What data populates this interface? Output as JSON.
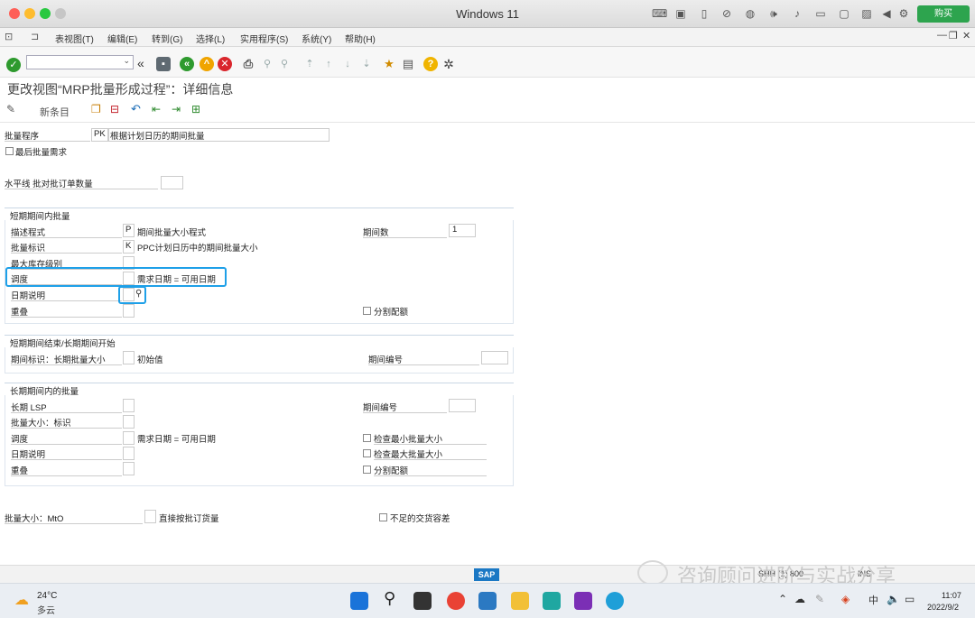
{
  "window": {
    "title": "Windows 11",
    "buy_label": "购买"
  },
  "menu": [
    "表视图(T)",
    "编辑(E)",
    "转到(G)",
    "选择(L)",
    "实用程序(S)",
    "系统(Y)",
    "帮助(H)"
  ],
  "page_title": "更改视图“MRP批量形成过程”：详细信息",
  "app_toolbar": {
    "new_entries": "新条目"
  },
  "form": {
    "lot_procedure": {
      "label": "批量程序",
      "code": "PK",
      "desc": "根据计划日历的期间批量"
    },
    "last_lot_exact": {
      "label": "最后批量需求"
    },
    "horizon": {
      "label": "水平线 批对批订单数量"
    },
    "short": {
      "title": "短期期间内批量",
      "desc_proc": {
        "label": "描述程式",
        "code": "P",
        "desc": "期间批量大小程式"
      },
      "periods": {
        "label": "期间数",
        "value": "1"
      },
      "lot_ind": {
        "label": "批量标识",
        "code": "K",
        "desc": "PPC计划日历中的期间批量大小"
      },
      "max_stock": {
        "label": "最大库存级别"
      },
      "scheduling": {
        "label": "调度",
        "desc": "需求日期 = 可用日期"
      },
      "date_spec": {
        "label": "日期说明"
      },
      "overlap": {
        "label": "重叠"
      },
      "split_quota": {
        "label": "分割配额"
      }
    },
    "transition": {
      "title": "短期期间结束/长期期间开始",
      "period_ind": {
        "label": "期间标识：长期批量大小",
        "desc": "初始值"
      },
      "period_no": {
        "label": "期间编号"
      }
    },
    "long": {
      "title": "长期期间内的批量",
      "lsp": {
        "label": "长期 LSP"
      },
      "period_no": {
        "label": "期间编号"
      },
      "lot_ind": {
        "label": "批量大小：标识"
      },
      "scheduling": {
        "label": "调度",
        "desc": "需求日期 = 可用日期"
      },
      "check_min": {
        "label": "检查最小批量大小"
      },
      "date_spec": {
        "label": "日期说明"
      },
      "check_max": {
        "label": "检查最大批量大小"
      },
      "overlap": {
        "label": "重叠"
      },
      "split_quota": {
        "label": "分割配额"
      }
    },
    "mto": {
      "label": "批量大小：MtO",
      "direct": "直接按批订货量",
      "shortage": "不足的交货容差"
    }
  },
  "status_bar": {
    "sap": "SAP",
    "system": "SHH (1) 800",
    "mode": "INS"
  },
  "watermark": "咨询顾问进阶与实战分享",
  "taskbar": {
    "temp": "24°C",
    "weather": "多云",
    "time": "11:07",
    "date": "2022/9/2"
  }
}
